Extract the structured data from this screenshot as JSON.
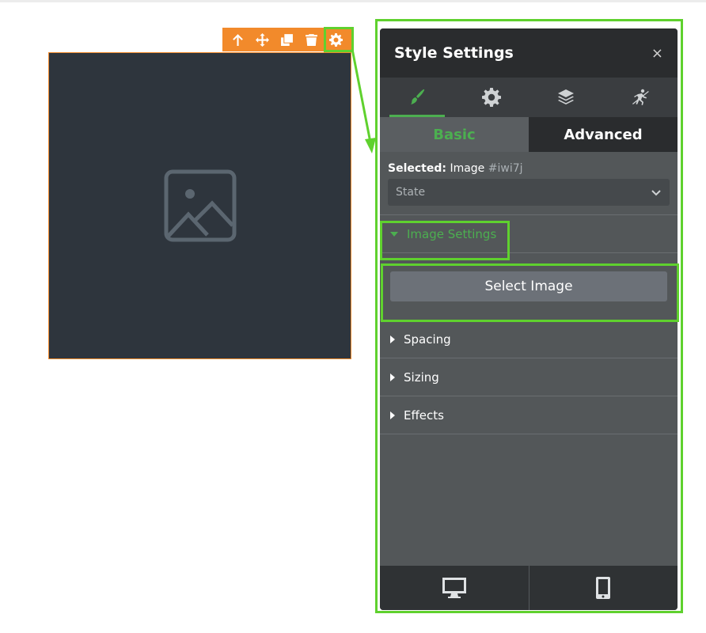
{
  "toolbar": {
    "icons": [
      "arrow-up-icon",
      "move-icon",
      "clone-icon",
      "trash-icon",
      "gear-icon"
    ],
    "color": "#f28a2b"
  },
  "canvas": {
    "image_placeholder_icon": "image-placeholder-icon",
    "background": "#2e353d"
  },
  "panel": {
    "title": "Style Settings",
    "close": "×",
    "icon_tabs": [
      {
        "icon": "brush-icon",
        "active": true
      },
      {
        "icon": "gear-icon",
        "active": false
      },
      {
        "icon": "layers-icon",
        "active": false
      },
      {
        "icon": "interaction-icon",
        "active": false
      }
    ],
    "sub_tabs": {
      "basic": "Basic",
      "advanced": "Advanced"
    },
    "selected": {
      "label": "Selected:",
      "type": "Image",
      "id": "#iwi7j"
    },
    "state": {
      "value": "State"
    },
    "sections": {
      "image_settings": "Image Settings",
      "select_image": "Select Image",
      "spacing": "Spacing",
      "sizing": "Sizing",
      "effects": "Effects"
    },
    "footer": {
      "desktop_icon": "desktop-icon",
      "mobile_icon": "mobile-icon"
    },
    "accent": "#4caf50"
  },
  "highlight_color": "#5fd12e"
}
